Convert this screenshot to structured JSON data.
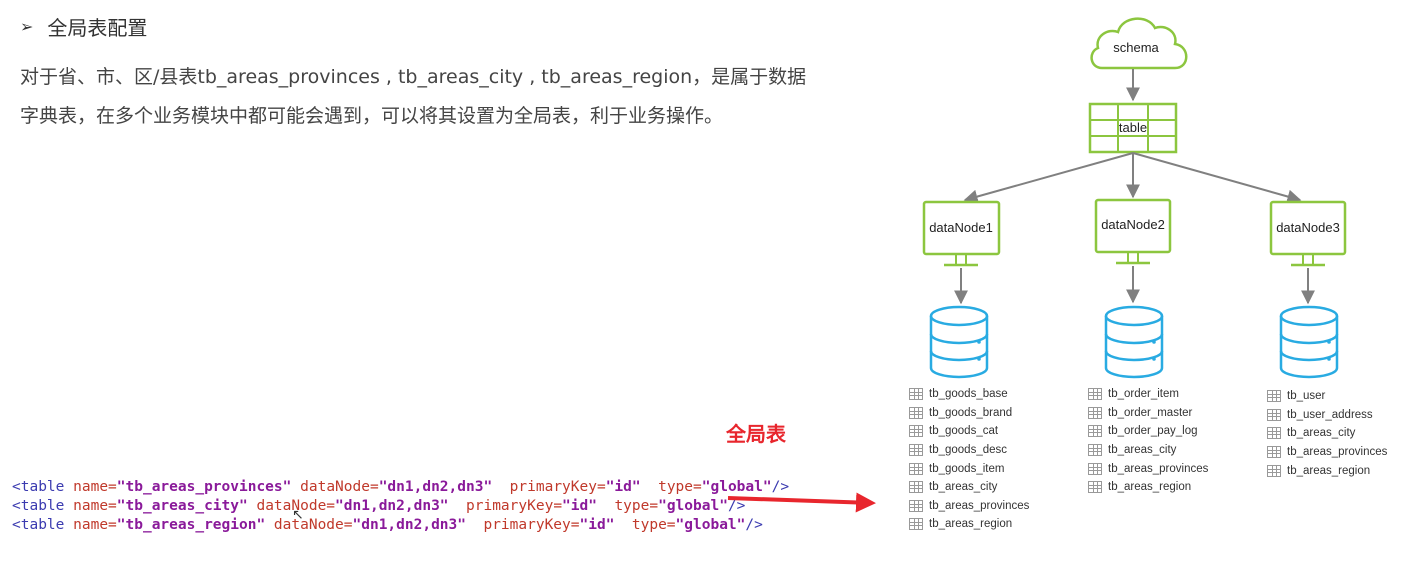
{
  "heading": {
    "bullet": "➢",
    "title": "全局表配置"
  },
  "paragraph": {
    "line1": "对于省、市、区/县表tb_areas_provinces , tb_areas_city , tb_areas_region，是属于数据",
    "line2": "字典表，在多个业务模块中都可能会遇到，可以将其设置为全局表，利于业务操作。"
  },
  "annotation": {
    "label": "全局表",
    "color": "#e8262d"
  },
  "code_lines": [
    {
      "tag_open": "<table",
      "name_attr": "name=",
      "name_val": "\"tb_areas_provinces\"",
      "dn_attr": "dataNode=",
      "dn_val": "\"dn1,dn2,dn3\"",
      "pk_attr": "primaryKey=",
      "pk_val": "\"id\"",
      "type_attr": "type=",
      "type_val": "\"global\"",
      "tag_close": "/>"
    },
    {
      "tag_open": "<table",
      "name_attr": "name=",
      "name_val": "\"tb_areas_city\"",
      "dn_attr": "dataNode=",
      "dn_val": "\"dn1,dn2,dn3\"",
      "pk_attr": "primaryKey=",
      "pk_val": "\"id\"",
      "type_attr": "type=",
      "type_val": "\"global\"",
      "tag_close": "/>"
    },
    {
      "tag_open": "<table",
      "name_attr": "name=",
      "name_val": "\"tb_areas_region\"",
      "dn_attr": "dataNode=",
      "dn_val": "\"dn1,dn2,dn3\"",
      "pk_attr": "primaryKey=",
      "pk_val": "\"id\"",
      "type_attr": "type=",
      "type_val": "\"global\"",
      "tag_close": "/>"
    }
  ],
  "diagram": {
    "schema_label": "schema",
    "table_label": "table",
    "nodes": [
      {
        "label": "dataNode1",
        "tables": [
          "tb_goods_base",
          "tb_goods_brand",
          "tb_goods_cat",
          "tb_goods_desc",
          "tb_goods_item",
          "tb_areas_city",
          "tb_areas_provinces",
          "tb_areas_region"
        ]
      },
      {
        "label": "dataNode2",
        "tables": [
          "tb_order_item",
          "tb_order_master",
          "tb_order_pay_log",
          "tb_areas_city",
          "tb_areas_provinces",
          "tb_areas_region"
        ]
      },
      {
        "label": "dataNode3",
        "tables": [
          "tb_user",
          "tb_user_address",
          "tb_areas_city",
          "tb_areas_provinces",
          "tb_areas_region"
        ]
      }
    ],
    "colors": {
      "green": "#8cc63f",
      "blue": "#29abe2",
      "arrow": "#808080"
    }
  }
}
